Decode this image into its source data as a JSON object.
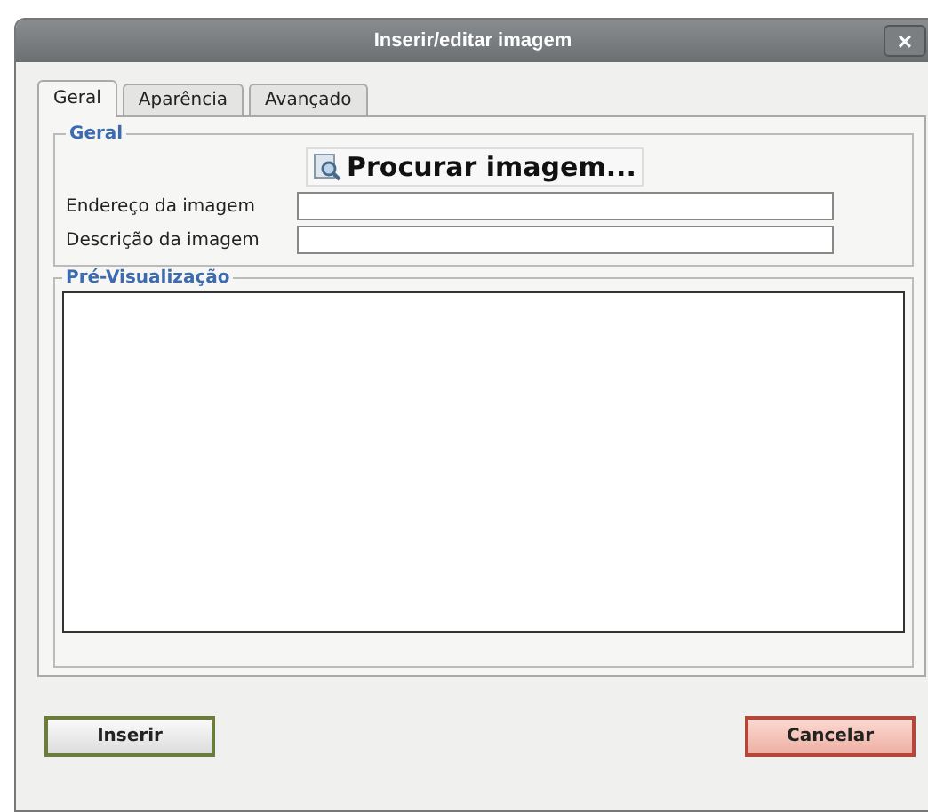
{
  "window": {
    "title": "Inserir/editar imagem",
    "close": "×"
  },
  "tabs": [
    {
      "label": "Geral",
      "selected": true
    },
    {
      "label": "Aparência",
      "selected": false
    },
    {
      "label": "Avançado",
      "selected": false
    }
  ],
  "general": {
    "legend": "Geral",
    "browse_button": "Procurar imagem...",
    "fields": [
      {
        "label": "Endereço da imagem"
      },
      {
        "label": "Descrição da imagem"
      }
    ]
  },
  "preview": {
    "legend": "Pré-Visualização"
  },
  "buttons": [
    {
      "label": "Inserir",
      "kind": "confirm"
    },
    {
      "label": "Cancelar",
      "kind": "cancel"
    }
  ]
}
